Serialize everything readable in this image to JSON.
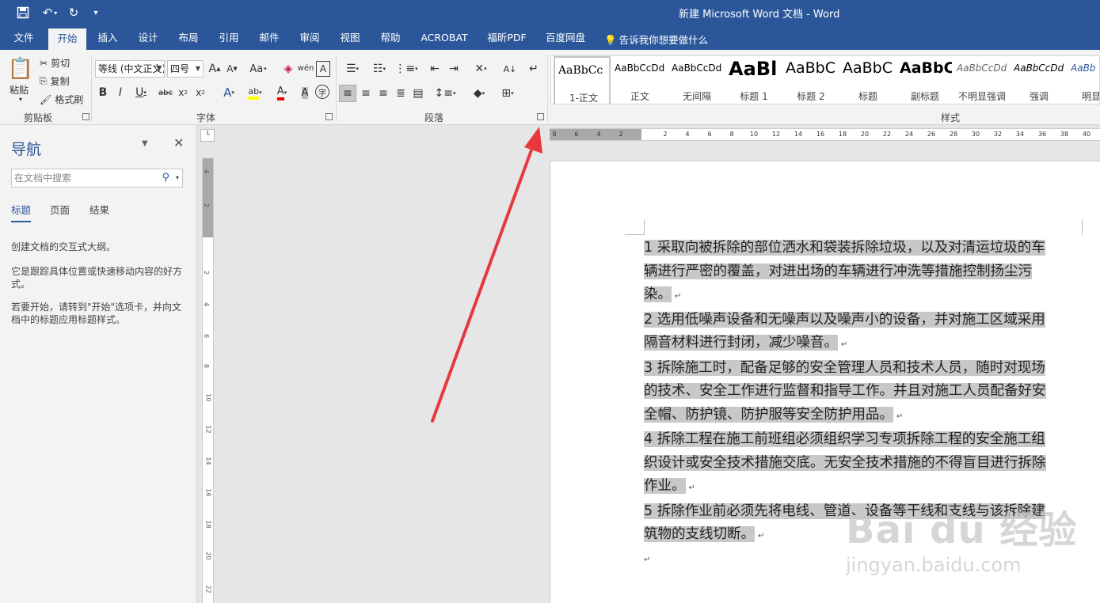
{
  "titlebar": {
    "title": "新建 Microsoft Word 文档  -  Word"
  },
  "tabs": [
    "文件",
    "开始",
    "插入",
    "设计",
    "布局",
    "引用",
    "邮件",
    "审阅",
    "视图",
    "帮助",
    "ACROBAT",
    "福昕PDF",
    "百度网盘"
  ],
  "active_tab": "开始",
  "tellme": "告诉我你想要做什么",
  "clipboard": {
    "paste": "粘贴",
    "cut": "剪切",
    "copy": "复制",
    "format_painter": "格式刷",
    "label": "剪贴板"
  },
  "font": {
    "name": "等线 (中文正文)",
    "size": "四号",
    "label": "字体"
  },
  "paragraph": {
    "label": "段落"
  },
  "styles": {
    "label": "样式",
    "items": [
      {
        "sample": "AaBbCc",
        "name": "1-正文"
      },
      {
        "sample": "AaBbCcDd",
        "name": "正文"
      },
      {
        "sample": "AaBbCcDd",
        "name": "无间隔"
      },
      {
        "sample": "AaBl",
        "name": "标题 1"
      },
      {
        "sample": "AaBbC",
        "name": "标题 2"
      },
      {
        "sample": "AaBbC",
        "name": "标题"
      },
      {
        "sample": "AaBbC",
        "name": "副标题"
      },
      {
        "sample": "AaBbCcDd",
        "name": "不明显强调"
      },
      {
        "sample": "AaBbCcDd",
        "name": "强调"
      },
      {
        "sample": "AaBb",
        "name": "明显强"
      }
    ]
  },
  "nav": {
    "title": "导航",
    "search_placeholder": "在文档中搜索",
    "tabs": [
      "标题",
      "页面",
      "结果"
    ],
    "msg1": "创建文档的交互式大纲。",
    "msg2": "它是跟踪具体位置或快速移动内容的好方式。",
    "msg3": "若要开始，请转到\"开始\"选项卡，并向文档中的标题应用标题样式。"
  },
  "hruler_ticks": [
    "8",
    "6",
    "4",
    "2",
    "2",
    "4",
    "6",
    "8",
    "10",
    "12",
    "14",
    "16",
    "18",
    "20",
    "22",
    "24",
    "26",
    "28",
    "30",
    "32",
    "34",
    "36",
    "38",
    "40"
  ],
  "vruler_ticks": [
    "4",
    "2",
    "2",
    "4",
    "6",
    "8",
    "10",
    "12",
    "14",
    "16",
    "18",
    "20",
    "22"
  ],
  "document": {
    "paragraphs": [
      [
        "1   采取向被拆除的部位洒水和袋装拆除垃圾，以及对清运垃圾的车",
        "辆进行严密的覆盖，对进出场的车辆进行冲洗等措施控制扬尘污",
        "染。"
      ],
      [
        "2   选用低噪声设备和无噪声以及噪声小的设备，并对施工区域采用",
        "隔音材料进行封闭，减少噪音。"
      ],
      [
        "3   拆除施工时，配备足够的安全管理人员和技术人员，随时对现场",
        "的技术、安全工作进行监督和指导工作。并且对施工人员配备好安",
        "全帽、防护镜、防护服等安全防护用品。"
      ],
      [
        "4   拆除工程在施工前班组必须组织学习专项拆除工程的安全施工组",
        "织设计或安全技术措施交底。无安全技术措施的不得盲目进行拆除",
        "作业。"
      ],
      [
        "5   拆除作业前必须先将电线、管道、设备等干线和支线与该拆除建",
        "筑物的支线切断。"
      ]
    ]
  },
  "watermark": {
    "brand": "Bai du 经验",
    "url": "jingyan.baidu.com"
  },
  "colors": {
    "titlebar": "#2b579a",
    "arrow": "#e8383d",
    "highlight": "#c8c8c8"
  }
}
